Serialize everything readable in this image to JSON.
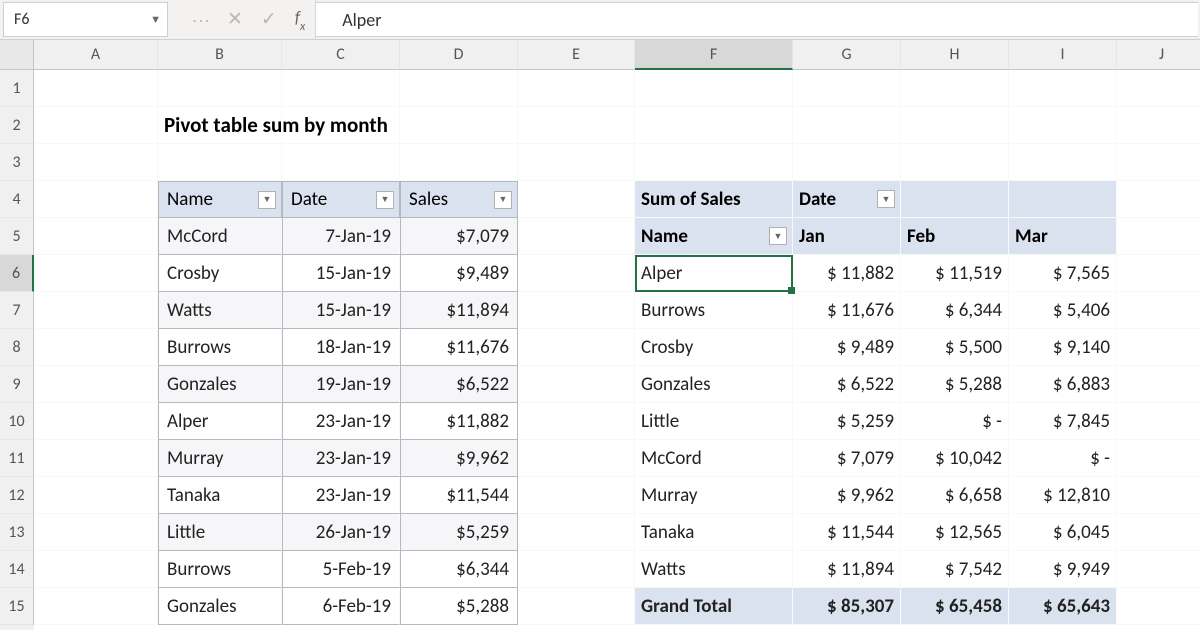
{
  "namebox": "F6",
  "formula_value": "Alper",
  "columns": [
    "A",
    "B",
    "C",
    "D",
    "E",
    "F",
    "G",
    "H",
    "I",
    "J"
  ],
  "active_col": "F",
  "row_headers": [
    "1",
    "2",
    "3",
    "4",
    "5",
    "6",
    "7",
    "8",
    "9",
    "10",
    "11",
    "12",
    "13",
    "14",
    "15"
  ],
  "active_row": "6",
  "title": "Pivot table sum by month",
  "source_table": {
    "headers": [
      "Name",
      "Date",
      "Sales"
    ],
    "rows": [
      {
        "name": "McCord",
        "date": "7-Jan-19",
        "sales": "$7,079"
      },
      {
        "name": "Crosby",
        "date": "15-Jan-19",
        "sales": "$9,489"
      },
      {
        "name": "Watts",
        "date": "15-Jan-19",
        "sales": "$11,894"
      },
      {
        "name": "Burrows",
        "date": "18-Jan-19",
        "sales": "$11,676"
      },
      {
        "name": "Gonzales",
        "date": "19-Jan-19",
        "sales": "$6,522"
      },
      {
        "name": "Alper",
        "date": "23-Jan-19",
        "sales": "$11,882"
      },
      {
        "name": "Murray",
        "date": "23-Jan-19",
        "sales": "$9,962"
      },
      {
        "name": "Tanaka",
        "date": "23-Jan-19",
        "sales": "$11,544"
      },
      {
        "name": "Little",
        "date": "26-Jan-19",
        "sales": "$5,259"
      },
      {
        "name": "Burrows",
        "date": "5-Feb-19",
        "sales": "$6,344"
      },
      {
        "name": "Gonzales",
        "date": "6-Feb-19",
        "sales": "$5,288"
      }
    ]
  },
  "pivot": {
    "measure_label": "Sum of Sales",
    "col_field": "Date",
    "row_field": "Name",
    "cols": [
      "Jan",
      "Feb",
      "Mar"
    ],
    "rows": [
      {
        "n": "Alper",
        "v": [
          "$ 11,882",
          "$ 11,519",
          "$  7,565"
        ]
      },
      {
        "n": "Burrows",
        "v": [
          "$ 11,676",
          "$  6,344",
          "$  5,406"
        ]
      },
      {
        "n": "Crosby",
        "v": [
          "$  9,489",
          "$  5,500",
          "$  9,140"
        ]
      },
      {
        "n": "Gonzales",
        "v": [
          "$  6,522",
          "$  5,288",
          "$  6,883"
        ]
      },
      {
        "n": "Little",
        "v": [
          "$  5,259",
          "$        -",
          "$  7,845"
        ]
      },
      {
        "n": "McCord",
        "v": [
          "$  7,079",
          "$ 10,042",
          "$        -"
        ]
      },
      {
        "n": "Murray",
        "v": [
          "$  9,962",
          "$  6,658",
          "$ 12,810"
        ]
      },
      {
        "n": "Tanaka",
        "v": [
          "$ 11,544",
          "$ 12,565",
          "$  6,045"
        ]
      },
      {
        "n": "Watts",
        "v": [
          "$ 11,894",
          "$  7,542",
          "$  9,949"
        ]
      }
    ],
    "grand_total_label": "Grand Total",
    "grand_totals": [
      "$ 85,307",
      "$ 65,458",
      "$ 65,643"
    ]
  },
  "chart_data": {
    "type": "table",
    "title": "Pivot table sum by month — Sum of Sales by Name and Month",
    "categories": [
      "Jan",
      "Feb",
      "Mar"
    ],
    "series": [
      {
        "name": "Alper",
        "values": [
          11882,
          11519,
          7565
        ]
      },
      {
        "name": "Burrows",
        "values": [
          11676,
          6344,
          5406
        ]
      },
      {
        "name": "Crosby",
        "values": [
          9489,
          5500,
          9140
        ]
      },
      {
        "name": "Gonzales",
        "values": [
          6522,
          5288,
          6883
        ]
      },
      {
        "name": "Little",
        "values": [
          5259,
          null,
          7845
        ]
      },
      {
        "name": "McCord",
        "values": [
          7079,
          10042,
          null
        ]
      },
      {
        "name": "Murray",
        "values": [
          9962,
          6658,
          12810
        ]
      },
      {
        "name": "Tanaka",
        "values": [
          11544,
          12565,
          6045
        ]
      },
      {
        "name": "Watts",
        "values": [
          11894,
          7542,
          9949
        ]
      }
    ],
    "grand_total": [
      85307,
      65458,
      65643
    ]
  }
}
